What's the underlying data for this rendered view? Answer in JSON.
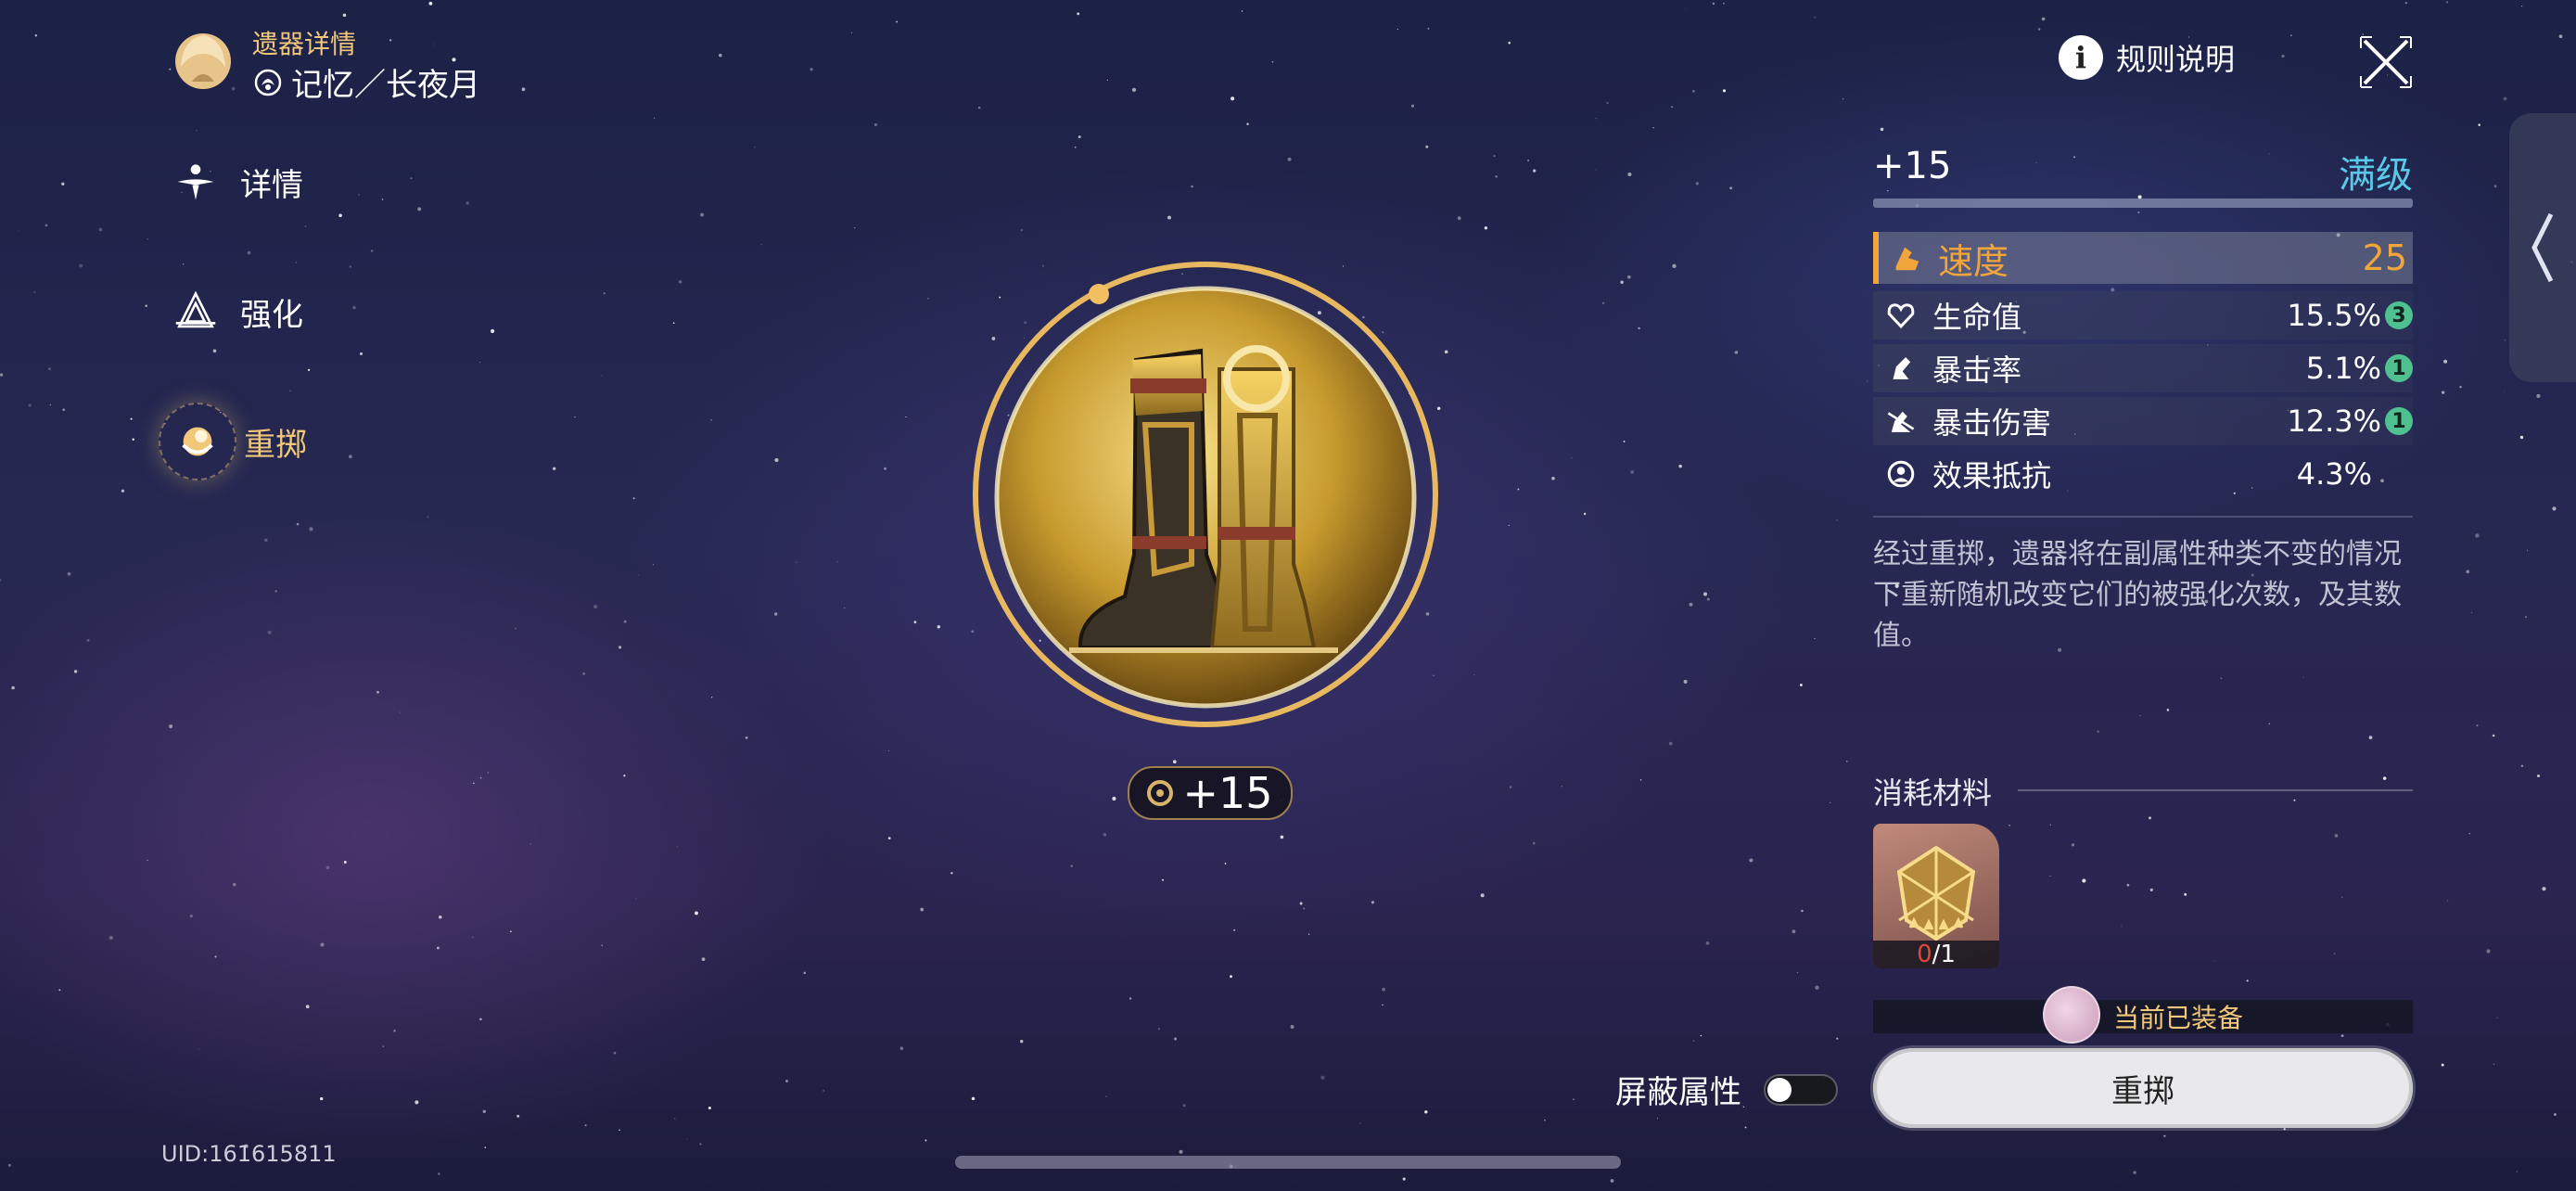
{
  "header": {
    "section_label": "遗器详情",
    "relic_set_title": "记忆／长夜月"
  },
  "nav": {
    "items": [
      {
        "label": "详情",
        "icon": "details-icon",
        "active": false
      },
      {
        "label": "强化",
        "icon": "enhance-icon",
        "active": false
      },
      {
        "label": "重掷",
        "icon": "reroll-icon",
        "active": true
      }
    ]
  },
  "relic": {
    "level_badge": "+15",
    "icon": "golden-boots-relic"
  },
  "top_right": {
    "rules_label": "规则说明",
    "rules_icon": "info-icon",
    "close_icon": "close-icon",
    "side_tab_icon": "chevron-left-icon"
  },
  "stats": {
    "level": "+15",
    "level_status": "满级",
    "main": {
      "name": "速度",
      "value": "25"
    },
    "subs": [
      {
        "name": "生命值",
        "value": "15.5%",
        "rolls": "3"
      },
      {
        "name": "暴击率",
        "value": "5.1%",
        "rolls": "1"
      },
      {
        "name": "暴击伤害",
        "value": "12.3%",
        "rolls": "1"
      },
      {
        "name": "效果抵抗",
        "value": "4.3%",
        "rolls": ""
      }
    ],
    "description": "经过重掷，遗器将在副属性种类不变的情况下重新随机改变它们的被强化次数，及其数值。"
  },
  "materials": {
    "title": "消耗材料",
    "items": [
      {
        "have": "0",
        "need": "/1",
        "stars": 5
      }
    ]
  },
  "equipped_label": "当前已装备",
  "reroll_button": "重掷",
  "mask_toggle": {
    "label": "屏蔽属性",
    "on": false
  },
  "uid": "UID:161615811",
  "colors": {
    "accent_gold": "#f2c77a",
    "main_stat": "#f2a53a",
    "max_level": "#5bc8e8",
    "roll_badge": "#4fc08f"
  }
}
